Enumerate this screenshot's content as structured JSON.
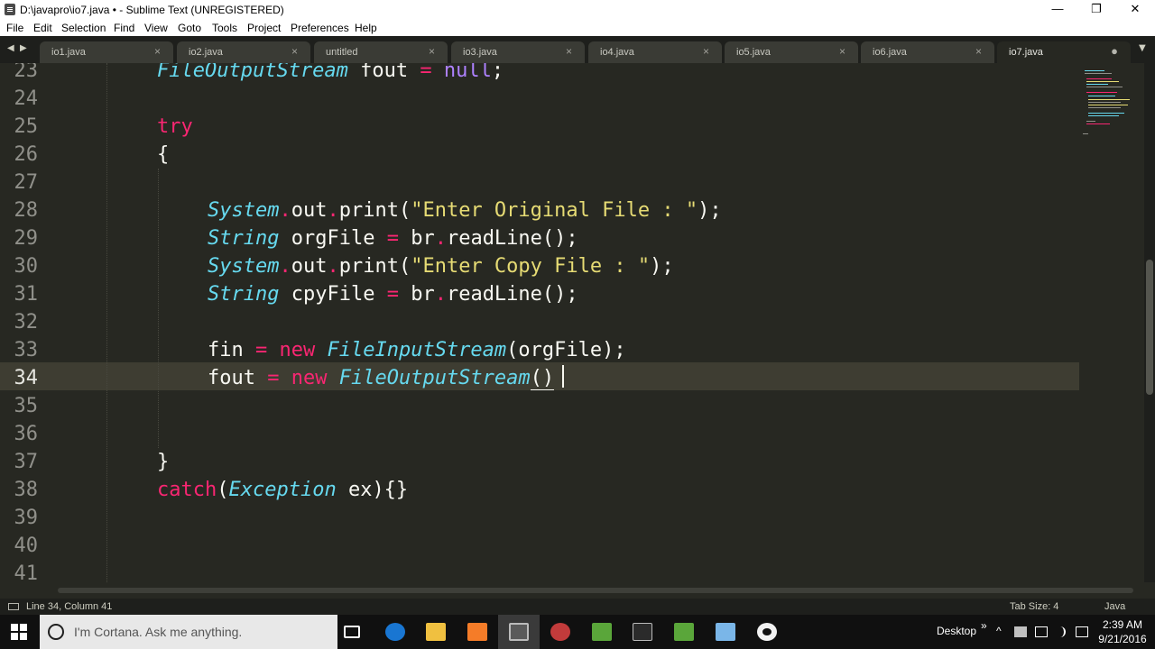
{
  "window": {
    "title": "D:\\javapro\\io7.java • - Sublime Text (UNREGISTERED)",
    "minimize": "—",
    "restore": "❐",
    "close": "✕"
  },
  "menu": [
    "File",
    "Edit",
    "Selection",
    "Find",
    "View",
    "Goto",
    "Tools",
    "Project",
    "Preferences",
    "Help"
  ],
  "tabs": [
    {
      "label": "io1.java",
      "close": "×"
    },
    {
      "label": "io2.java",
      "close": "×"
    },
    {
      "label": "untitled",
      "close": "×"
    },
    {
      "label": "io3.java",
      "close": "×"
    },
    {
      "label": "io4.java",
      "close": "×"
    },
    {
      "label": "io5.java",
      "close": "×"
    },
    {
      "label": "io6.java",
      "close": "×"
    },
    {
      "label": "io7.java",
      "close": "●",
      "active": true
    }
  ],
  "nav": {
    "left": "◀",
    "right": "▶",
    "overflow": "▼"
  },
  "editor": {
    "line_numbers": [
      "23",
      "24",
      "25",
      "26",
      "27",
      "28",
      "29",
      "30",
      "31",
      "32",
      "33",
      "34",
      "35",
      "36",
      "37",
      "38",
      "39",
      "40",
      "41"
    ],
    "current_line": "34",
    "tokens": {
      "l23": [
        "FileOutputStream",
        " fout ",
        "=",
        " ",
        "null",
        ";"
      ],
      "l25": [
        "try"
      ],
      "l26": [
        "{"
      ],
      "l28": [
        "System",
        ".",
        "out",
        ".",
        "print(",
        "\"Enter Original File : \"",
        ");"
      ],
      "l29": [
        "String",
        " orgFile ",
        "=",
        " br",
        ".",
        "readLine();"
      ],
      "l30": [
        "System",
        ".",
        "out",
        ".",
        "print(",
        "\"Enter Copy File : \"",
        ");"
      ],
      "l31": [
        "String",
        " cpyFile ",
        "=",
        " br",
        ".",
        "readLine();"
      ],
      "l33": [
        "fin ",
        "=",
        " ",
        "new",
        " ",
        "FileInputStream",
        "(orgFile);"
      ],
      "l34": [
        "fout ",
        "=",
        " ",
        "new",
        " ",
        "FileOutputStream",
        "(",
        ")"
      ],
      "l37": [
        "}"
      ],
      "l38": [
        "catch",
        "(",
        "Exception",
        " ex){}"
      ]
    }
  },
  "status": {
    "position": "Line 34, Column 41",
    "tab_size": "Tab Size: 4",
    "syntax": "Java"
  },
  "taskbar": {
    "search_placeholder": "I'm Cortana. Ask me anything.",
    "desktop_label": "Desktop",
    "chevrons": "»",
    "up_arrow": "^",
    "time": "2:39 AM",
    "date": "9/21/2016"
  },
  "colors": {
    "background": "#272822",
    "keyword": "#f92672",
    "type": "#66d9ef",
    "string": "#e6db74",
    "text": "#f8f8f2"
  }
}
